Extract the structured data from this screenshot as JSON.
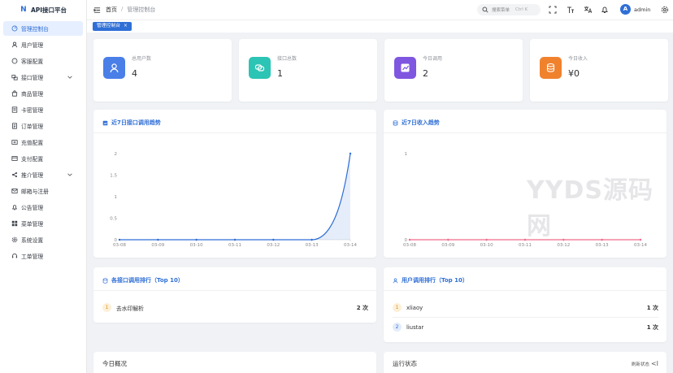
{
  "app": {
    "title": "API接口平台"
  },
  "sidebar": {
    "items": [
      {
        "label": "管理控制台",
        "icon": "dashboard-icon"
      },
      {
        "label": "用户管理",
        "icon": "user-icon"
      },
      {
        "label": "客服配置",
        "icon": "chat-icon"
      },
      {
        "label": "接口管理",
        "icon": "interface-icon"
      },
      {
        "label": "商品管理",
        "icon": "shop-icon"
      },
      {
        "label": "卡密管理",
        "icon": "card-icon"
      },
      {
        "label": "订单管理",
        "icon": "order-icon"
      },
      {
        "label": "充值配置",
        "icon": "recharge-icon"
      },
      {
        "label": "支付配置",
        "icon": "payment-icon"
      },
      {
        "label": "推介管理",
        "icon": "share-icon"
      },
      {
        "label": "邮箱与注册",
        "icon": "mail-icon"
      },
      {
        "label": "公告管理",
        "icon": "bell-icon"
      },
      {
        "label": "菜单管理",
        "icon": "menu-grid-icon"
      },
      {
        "label": "系统设置",
        "icon": "gear-icon"
      },
      {
        "label": "工单管理",
        "icon": "headset-icon"
      }
    ]
  },
  "header": {
    "breadcrumb_home": "首页",
    "breadcrumb_sep": "/",
    "breadcrumb_current": "管理控制台",
    "search_placeholder": "搜索菜单",
    "search_shortcut": "Ctrl K",
    "username": "admin",
    "avatar_letter": "A"
  },
  "tags": {
    "active_label": "管理控制台",
    "close": "×"
  },
  "stats": [
    {
      "label": "总用户数",
      "value": "4",
      "color": "#4a7fe8"
    },
    {
      "label": "接口总数",
      "value": "1",
      "color": "#2cc4b4"
    },
    {
      "label": "今日调用",
      "value": "2",
      "color": "#7f56e0"
    },
    {
      "label": "今日收入",
      "value": "¥0",
      "color": "#f0822e"
    }
  ],
  "charts": {
    "calls_title": "近7日接口调用趋势",
    "income_title": "近7日收入趋势"
  },
  "chart_data": [
    {
      "type": "area",
      "title": "近7日接口调用趋势",
      "categories": [
        "03-08",
        "03-09",
        "03-10",
        "03-11",
        "03-12",
        "03-13",
        "03-14"
      ],
      "values": [
        0,
        0,
        0,
        0,
        0,
        0,
        2
      ],
      "y_ticks": [
        "0",
        "0.5",
        "1",
        "1.5",
        "2"
      ],
      "ylim": [
        0,
        2
      ],
      "grid": false,
      "line_color": "#2f6fd6",
      "smooth": true
    },
    {
      "type": "line",
      "title": "近7日收入趋势",
      "categories": [
        "03-08",
        "03-09",
        "03-10",
        "03-11",
        "03-12",
        "03-13",
        "03-14"
      ],
      "values": [
        0,
        0,
        0,
        0,
        0,
        0,
        0
      ],
      "y_ticks": [
        "0",
        "1"
      ],
      "ylim": [
        0,
        1
      ],
      "grid": false,
      "line_color": "#f06b8a"
    }
  ],
  "rankings": {
    "api_title": "各接口调用排行（Top 10）",
    "api_rows": [
      {
        "rank": "1",
        "name": "去水印解析",
        "count": "2 次"
      }
    ],
    "user_title": "用户调用排行（Top 10）",
    "user_rows": [
      {
        "rank": "1",
        "name": "xliaoy",
        "count": "1 次"
      },
      {
        "rank": "2",
        "name": "liustar",
        "count": "1 次"
      }
    ]
  },
  "bottom": {
    "today_title": "今日概况",
    "status_title": "运行状态",
    "refresh_label": "刷新状态"
  },
  "watermark": "YYDS源码网"
}
